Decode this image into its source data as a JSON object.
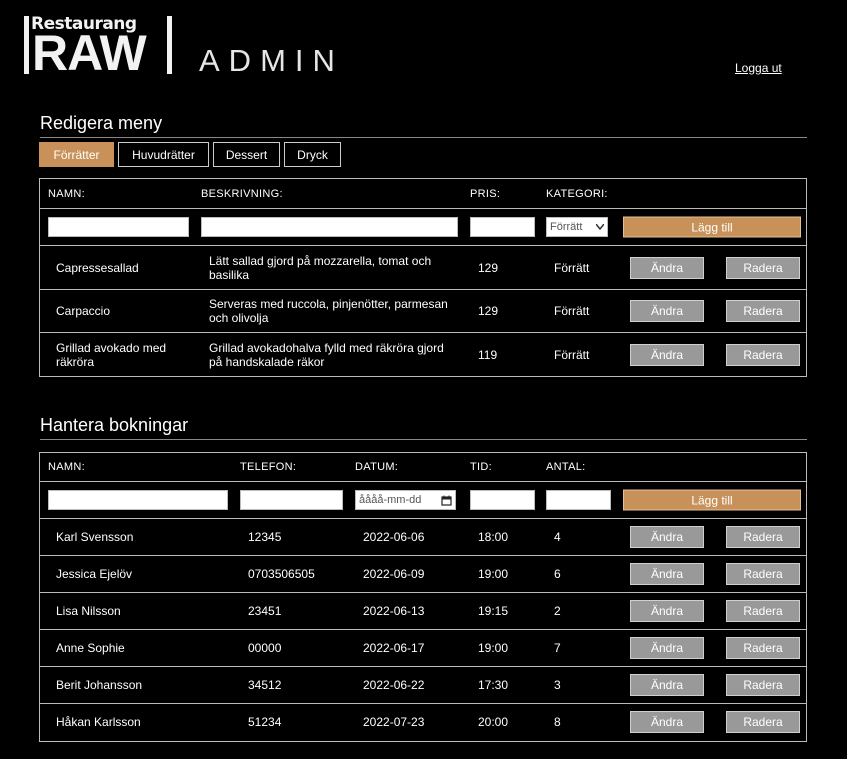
{
  "header": {
    "logo_small": "Restaurang",
    "logo_big": "RAW",
    "admin_title": "ADMIN",
    "logout_label": "Logga ut"
  },
  "menu_section": {
    "title": "Redigera meny",
    "tabs": [
      "Förrätter",
      "Huvudrätter",
      "Dessert",
      "Dryck"
    ],
    "active_tab": "Förrätter",
    "columns": [
      "NAMN:",
      "BESKRIVNING:",
      "PRIS:",
      "KATEGORI:"
    ],
    "form": {
      "name_value": "",
      "description_value": "",
      "price_value": "",
      "category_selected": "Förrätt",
      "add_label": "Lägg till"
    },
    "rows": [
      {
        "name": "Capressesallad",
        "description": "Lätt sallad gjord på mozzarella, tomat och basilika",
        "price": "129",
        "category": "Förrätt"
      },
      {
        "name": "Carpaccio",
        "description": "Serveras med ruccola, pinjenötter, parmesan och olivolja",
        "price": "129",
        "category": "Förrätt"
      },
      {
        "name": "Grillad avokado med räkröra",
        "description": "Grillad avokadohalva fylld med räkröra gjord på handskalade räkor",
        "price": "119",
        "category": "Förrätt"
      }
    ],
    "edit_label": "Ändra",
    "delete_label": "Radera"
  },
  "booking_section": {
    "title": "Hantera bokningar",
    "columns": [
      "NAMN:",
      "TELEFON:",
      "DATUM:",
      "TID:",
      "ANTAL:"
    ],
    "form": {
      "name_value": "",
      "phone_value": "",
      "date_placeholder": "åååå-mm-dd",
      "time_value": "",
      "count_value": "",
      "add_label": "Lägg till"
    },
    "rows": [
      {
        "name": "Karl Svensson",
        "phone": "12345",
        "date": "2022-06-06",
        "time": "18:00",
        "count": "4"
      },
      {
        "name": "Jessica Ejelöv",
        "phone": "0703506505",
        "date": "2022-06-09",
        "time": "19:00",
        "count": "6"
      },
      {
        "name": "Lisa Nilsson",
        "phone": "23451",
        "date": "2022-06-13",
        "time": "19:15",
        "count": "2"
      },
      {
        "name": "Anne Sophie",
        "phone": "00000",
        "date": "2022-06-17",
        "time": "19:00",
        "count": "7"
      },
      {
        "name": "Berit Johansson",
        "phone": "34512",
        "date": "2022-06-22",
        "time": "17:30",
        "count": "3"
      },
      {
        "name": "Håkan Karlsson",
        "phone": "51234",
        "date": "2022-07-23",
        "time": "20:00",
        "count": "8"
      }
    ],
    "edit_label": "Ändra",
    "delete_label": "Radera"
  },
  "colors": {
    "background": "#000000",
    "accent": "#c9915a",
    "button_gray": "#999999",
    "border": "#bbbbbb"
  },
  "icons": {
    "select_caret": "chevron-down-icon",
    "calendar": "calendar-icon"
  }
}
